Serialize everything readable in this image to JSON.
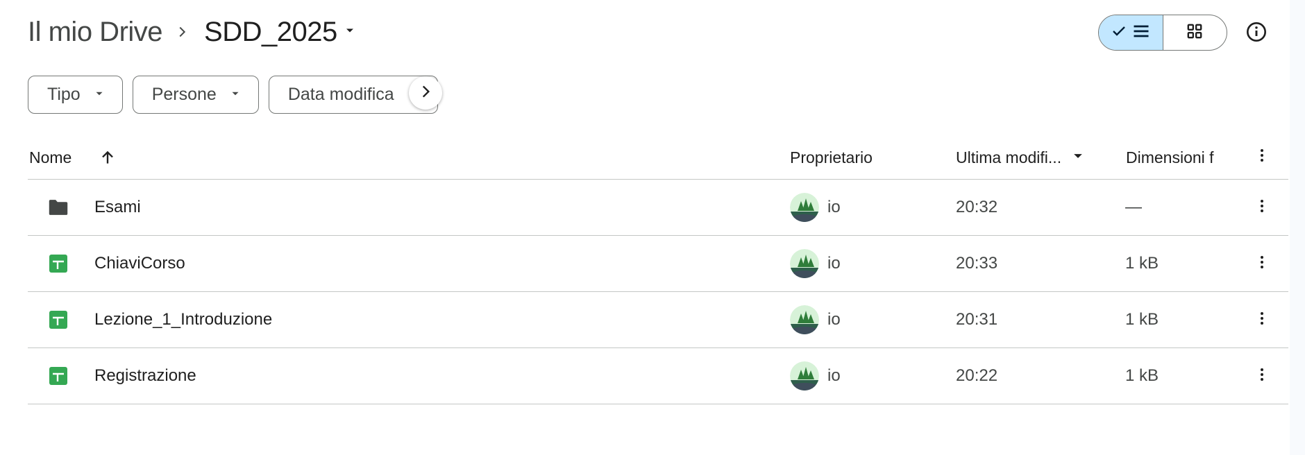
{
  "breadcrumb": {
    "root": "Il mio Drive",
    "current": "SDD_2025"
  },
  "filters": [
    {
      "label": "Tipo"
    },
    {
      "label": "Persone"
    },
    {
      "label": "Data modifica"
    }
  ],
  "columns": {
    "name": "Nome",
    "owner": "Proprietario",
    "modified": "Ultima modifi...",
    "size": "Dimensioni f"
  },
  "files": [
    {
      "name": "Esami",
      "type": "folder",
      "owner": "io",
      "modified": "20:32",
      "size": "—"
    },
    {
      "name": "ChiaviCorso",
      "type": "spreadsheet",
      "owner": "io",
      "modified": "20:33",
      "size": "1 kB"
    },
    {
      "name": "Lezione_1_Introduzione",
      "type": "spreadsheet",
      "owner": "io",
      "modified": "20:31",
      "size": "1 kB"
    },
    {
      "name": "Registrazione",
      "type": "spreadsheet",
      "owner": "io",
      "modified": "20:22",
      "size": "1 kB"
    }
  ],
  "colors": {
    "accent_selected": "#c2e7ff",
    "sheets_green": "#34a853",
    "folder": "#444746",
    "divider": "#c4c7c5"
  },
  "icons": [
    "chevron-right-icon",
    "dropdown-arrow-icon",
    "check-icon",
    "list-view-icon",
    "grid-view-icon",
    "info-icon",
    "arrow-up-icon",
    "more-vert-icon",
    "folder-icon",
    "spreadsheet-icon"
  ]
}
